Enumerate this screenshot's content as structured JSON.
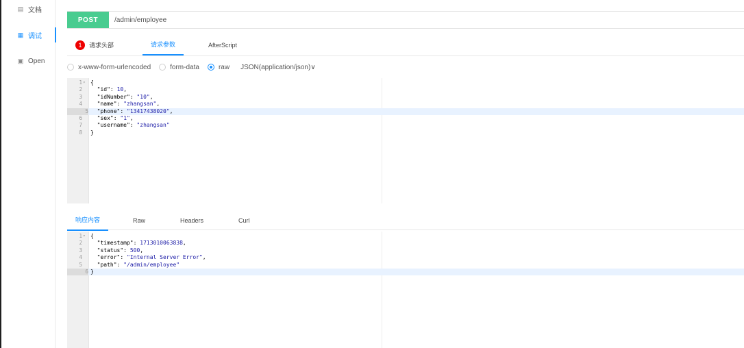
{
  "sidebar": {
    "items": [
      {
        "icon": "document-icon",
        "label": "文档"
      },
      {
        "icon": "debug-icon",
        "label": "调试"
      },
      {
        "icon": "open-file-icon",
        "label": "Open"
      }
    ],
    "active_index": 1
  },
  "request": {
    "method": "POST",
    "url": "/admin/employee",
    "method_color": "#49cc90"
  },
  "request_tabs": [
    {
      "label": "请求头部",
      "badge": "1"
    },
    {
      "label": "请求参数",
      "active": true
    },
    {
      "label": "AfterScript"
    }
  ],
  "body_types": {
    "options": [
      "x-www-form-urlencoded",
      "form-data",
      "raw"
    ],
    "selected": "raw",
    "content_type": "JSON(application/json)∨"
  },
  "request_body": {
    "highlighted_line": 5,
    "lines": [
      "{",
      "  \"id\": 10,",
      "  \"idNumber\": \"10\",",
      "  \"name\": \"zhangsan\",",
      "  \"phone\": \"13417438020\",",
      "  \"sex\": \"1\",",
      "  \"username\": \"zhangsan\"",
      "}"
    ]
  },
  "response_tabs": [
    {
      "label": "响应内容",
      "active": true
    },
    {
      "label": "Raw"
    },
    {
      "label": "Headers"
    },
    {
      "label": "Curl"
    }
  ],
  "response_body": {
    "highlighted_line": 6,
    "lines": [
      "{",
      "  \"timestamp\": 1713010063838,",
      "  \"status\": 500,",
      "  \"error\": \"Internal Server Error\",",
      "  \"path\": \"/admin/employee\"",
      "}"
    ]
  },
  "colors": {
    "accent": "#1890ff",
    "badge": "#ee0000"
  }
}
